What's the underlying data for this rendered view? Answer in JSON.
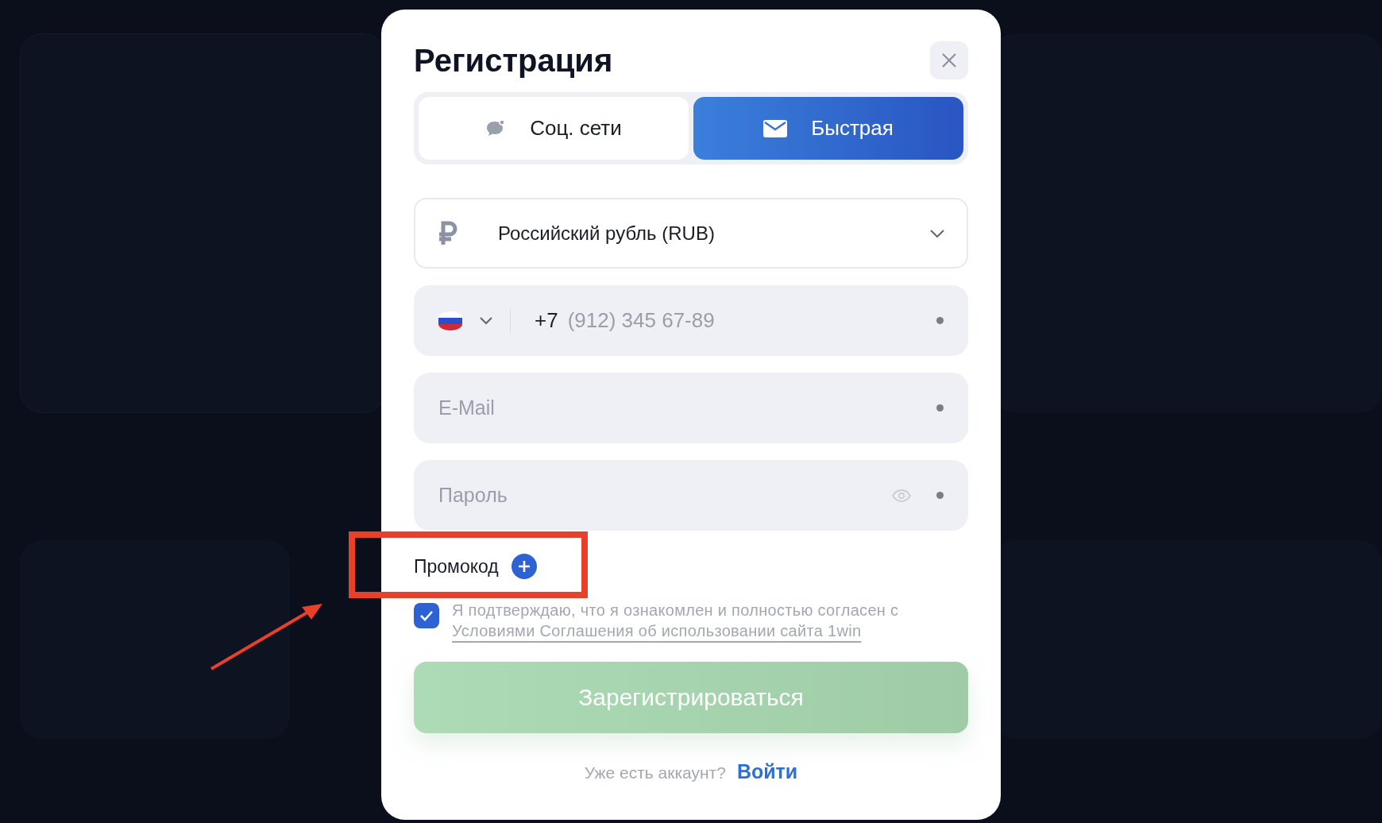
{
  "dialog": {
    "title": "Регистрация",
    "tabs": [
      {
        "label": "Соц. сети",
        "selected": false,
        "kind": "social"
      },
      {
        "label": "Быстрая",
        "selected": true,
        "kind": "email"
      }
    ],
    "currency": {
      "value": "Российский рубль (RUB)"
    },
    "phone": {
      "code": "+7",
      "placeholder": "(912) 345 67-89",
      "required": true
    },
    "email": {
      "placeholder": "E-Mail",
      "required": true
    },
    "password": {
      "placeholder": "Пароль",
      "required": true
    },
    "promo": {
      "label": "Промокод"
    },
    "agreement": {
      "checked": true,
      "text": "Я подтверждаю, что я ознакомлен и полностью согласен с",
      "link": "Условиями Соглашения об использовании сайта 1win"
    },
    "submit": {
      "label": "Зарегистрироваться",
      "disabled": true
    },
    "footer": {
      "text": "Уже есть аккаунт?",
      "link": "Войти"
    }
  }
}
